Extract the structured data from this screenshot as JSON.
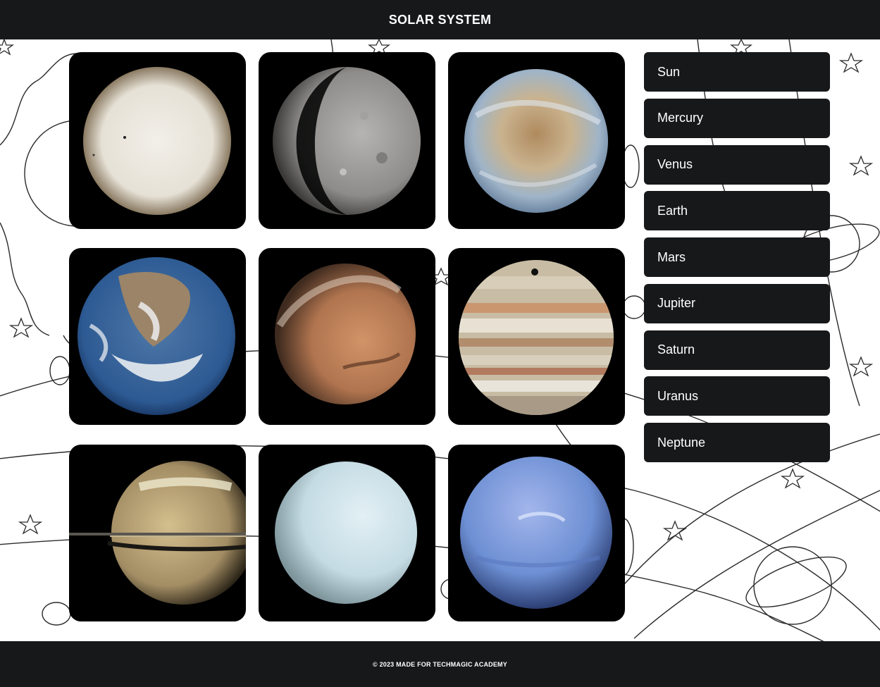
{
  "header": {
    "title": "SOLAR SYSTEM"
  },
  "tiles": [
    {
      "name": "Sun"
    },
    {
      "name": "Mercury"
    },
    {
      "name": "Venus"
    },
    {
      "name": "Earth"
    },
    {
      "name": "Mars"
    },
    {
      "name": "Jupiter"
    },
    {
      "name": "Saturn"
    },
    {
      "name": "Uranus"
    },
    {
      "name": "Neptune"
    }
  ],
  "nav": {
    "items": [
      {
        "label": "Sun"
      },
      {
        "label": "Mercury"
      },
      {
        "label": "Venus"
      },
      {
        "label": "Earth"
      },
      {
        "label": "Mars"
      },
      {
        "label": "Jupiter"
      },
      {
        "label": "Saturn"
      },
      {
        "label": "Uranus"
      },
      {
        "label": "Neptune"
      }
    ]
  },
  "footer": {
    "text": "© 2023 MADE FOR TECHMAGIC ACADEMY"
  },
  "colors": {
    "bar": "#17181a",
    "tile": "#000000",
    "text": "#ffffff"
  }
}
